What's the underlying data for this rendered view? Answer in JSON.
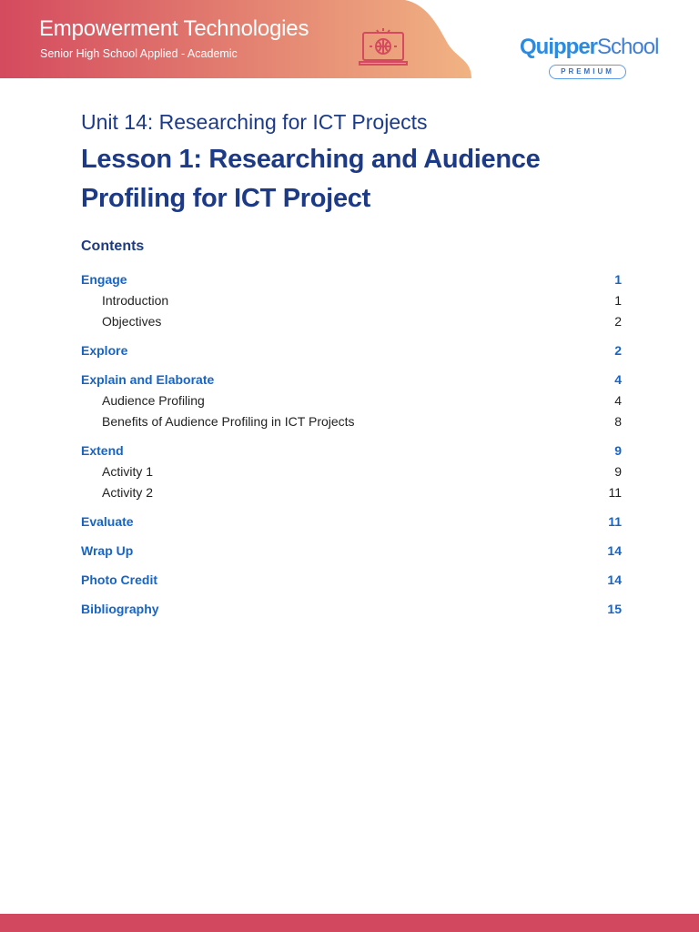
{
  "header": {
    "course": "Empowerment Technologies",
    "track": "Senior High School Applied - Academic",
    "logo_brand": "Quipper",
    "logo_school": "School",
    "logo_tier": "PREMIUM",
    "colors": {
      "banner_start": "#d44a5e",
      "banner_end": "#f1b383",
      "title": "#1c3a86",
      "link": "#1565c8"
    }
  },
  "unit": "Unit 14:  Researching for ICT Projects",
  "lesson": "Lesson 1: Researching and Audience Profiling for ICT Project",
  "contents_heading": "Contents",
  "toc": [
    {
      "label": "Engage",
      "page": "1",
      "level": "main"
    },
    {
      "label": "Introduction",
      "page": "1",
      "level": "sub"
    },
    {
      "label": "Objectives",
      "page": "2",
      "level": "sub"
    },
    {
      "label": "Explore",
      "page": "2",
      "level": "main"
    },
    {
      "label": "Explain and Elaborate",
      "page": "4",
      "level": "main"
    },
    {
      "label": "Audience Profiling",
      "page": "4",
      "level": "sub"
    },
    {
      "label": "Benefits of Audience Profiling in ICT Projects",
      "page": "8",
      "level": "sub"
    },
    {
      "label": "Extend",
      "page": "9",
      "level": "main"
    },
    {
      "label": "Activity 1",
      "page": "9",
      "level": "sub"
    },
    {
      "label": "Activity 2",
      "page": "11",
      "level": "sub"
    },
    {
      "label": "Evaluate",
      "page": "11",
      "level": "main"
    },
    {
      "label": "Wrap Up",
      "page": "14",
      "level": "main"
    },
    {
      "label": "Photo Credit",
      "page": "14",
      "level": "main"
    },
    {
      "label": "Bibliography",
      "page": "15",
      "level": "main"
    }
  ]
}
